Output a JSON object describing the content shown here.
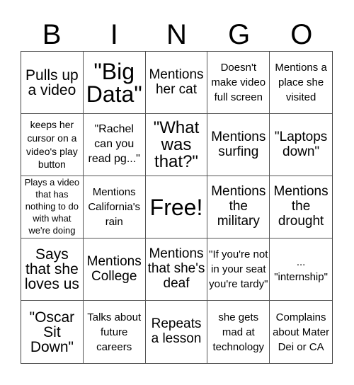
{
  "header": {
    "letters": [
      "B",
      "I",
      "N",
      "G",
      "O"
    ]
  },
  "cells": [
    "Pulls up a video",
    "\"Big Data\"",
    "Mentions her cat",
    "Doesn't make video full screen",
    "Mentions a place she visited",
    "keeps her cursor on a video's play button",
    "\"Rachel can you read pg...\"",
    "\"What was that?\"",
    "Mentions surfing",
    "\"Laptops down\"",
    "Plays a video that has nothing to do with what we're doing",
    "Mentions California's rain",
    "Free!",
    "Mentions the military",
    "Mentions the drought",
    "Says that she loves us",
    "Mentions College",
    "Mentions that she's deaf",
    "\"If you're not in your seat you're tardy\"",
    "... \"internship\"",
    "\"Oscar Sit Down\"",
    "Talks about future careers",
    "Repeats a lesson",
    "she gets mad at technology",
    "Complains about Mater Dei or CA"
  ]
}
